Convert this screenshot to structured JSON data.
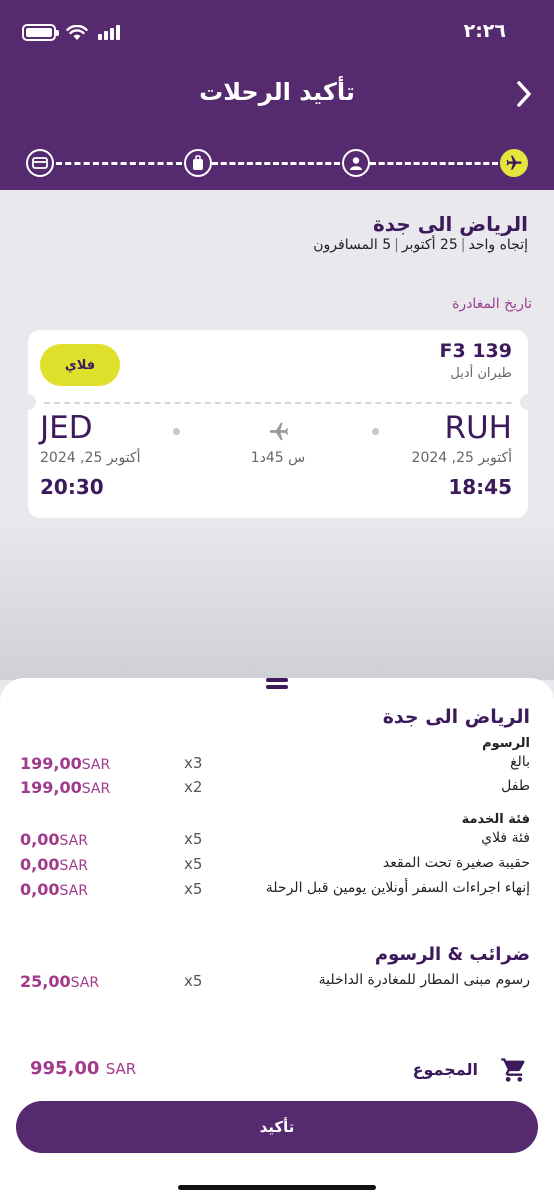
{
  "status_bar": {
    "time": "٢:٢٦"
  },
  "header": {
    "title": "تأكيد الرحلات"
  },
  "stepper": {
    "icons": [
      "payment-card-icon",
      "baggage-icon",
      "passenger-icon",
      "flight-icon"
    ],
    "active_color": "#e4e63d"
  },
  "summary": {
    "route": "الرياض الى جدة",
    "trip_type": "إتجاه واحد",
    "date": "25 أكتوبر",
    "passengers": "5 المسافرون"
  },
  "departure_label": "تاريخ المغادرة",
  "flight": {
    "number": "F3 139",
    "airline": "طيران أديل",
    "fare": "فلاي",
    "origin_code": "RUH",
    "origin_date": "أكتوبر 25, 2024",
    "origin_time": "18:45",
    "dest_code": "JED",
    "dest_date": "أكتوبر 25, 2024",
    "dest_time": "20:30",
    "duration": "1س 45د"
  },
  "breakdown": {
    "title": "الرياض الى جدة",
    "fees_title": "الرسوم",
    "fees": [
      {
        "label": "بالغ",
        "qty": "x3",
        "amount": "199,00",
        "currency": "SAR"
      },
      {
        "label": "طفل",
        "qty": "x2",
        "amount": "199,00",
        "currency": "SAR"
      }
    ],
    "service_title": "فئة الخدمة",
    "services": [
      {
        "label": "فئة فلاي",
        "qty": "x5",
        "amount": "0,00",
        "currency": "SAR"
      },
      {
        "label": "حقيبة صغيرة تحت المقعد",
        "qty": "x5",
        "amount": "0,00",
        "currency": "SAR"
      },
      {
        "label": "إنهاء اجراءات السفر أونلاين يومين قبل الرحلة",
        "qty": "x5",
        "amount": "0,00",
        "currency": "SAR"
      }
    ],
    "taxes_title": "ضرائب & الرسوم",
    "taxes": [
      {
        "label": "رسوم مبنى المطار للمغادرة الداخلية",
        "qty": "x5",
        "amount": "25,00",
        "currency": "SAR"
      }
    ]
  },
  "total": {
    "label": "المجموع",
    "amount": "995,00",
    "currency": "SAR"
  },
  "confirm_button": "تأكيد",
  "colors": {
    "brand": "#552a6f",
    "accent": "#dfe02c",
    "price": "#a23a8c"
  }
}
